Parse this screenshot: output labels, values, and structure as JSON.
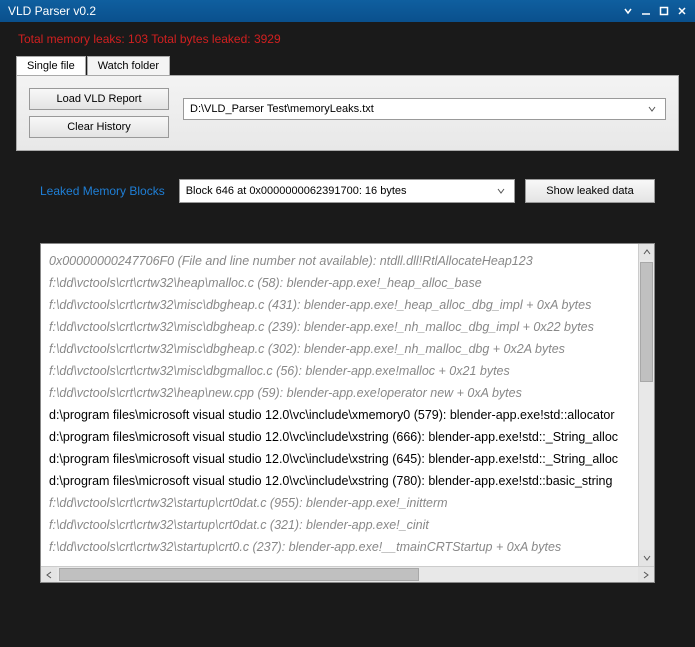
{
  "window": {
    "title": "VLD Parser v0.2"
  },
  "status": {
    "leaks_label": "Total memory leaks:",
    "leaks_count": "103",
    "bytes_label": "Total bytes leaked:",
    "bytes_count": "3929"
  },
  "tabs": {
    "single": "Single file",
    "watch": "Watch folder"
  },
  "panel": {
    "load_btn": "Load VLD Report",
    "clear_btn": "Clear History",
    "file_path": "D:\\VLD_Parser Test\\memoryLeaks.txt"
  },
  "mid": {
    "label": "Leaked Memory Blocks",
    "selected_block": "Block 646 at 0x0000000062391700: 16 bytes",
    "show_btn": "Show leaked data"
  },
  "trace": [
    {
      "dim": true,
      "text": "0x00000000247706F0 (File and line number not available): ntdll.dll!RtlAllocateHeap123"
    },
    {
      "dim": true,
      "text": "f:\\dd\\vctools\\crt\\crtw32\\heap\\malloc.c (58): blender-app.exe!_heap_alloc_base"
    },
    {
      "dim": true,
      "text": "f:\\dd\\vctools\\crt\\crtw32\\misc\\dbgheap.c (431): blender-app.exe!_heap_alloc_dbg_impl + 0xA bytes"
    },
    {
      "dim": true,
      "text": "f:\\dd\\vctools\\crt\\crtw32\\misc\\dbgheap.c (239): blender-app.exe!_nh_malloc_dbg_impl + 0x22 bytes"
    },
    {
      "dim": true,
      "text": "f:\\dd\\vctools\\crt\\crtw32\\misc\\dbgheap.c (302): blender-app.exe!_nh_malloc_dbg + 0x2A bytes"
    },
    {
      "dim": true,
      "text": "f:\\dd\\vctools\\crt\\crtw32\\misc\\dbgmalloc.c (56): blender-app.exe!malloc + 0x21 bytes"
    },
    {
      "dim": true,
      "text": "f:\\dd\\vctools\\crt\\crtw32\\heap\\new.cpp (59): blender-app.exe!operator new + 0xA bytes"
    },
    {
      "dim": false,
      "text": "d:\\program files\\microsoft visual studio 12.0\\vc\\include\\xmemory0 (579): blender-app.exe!std::allocator"
    },
    {
      "dim": false,
      "text": "d:\\program files\\microsoft visual studio 12.0\\vc\\include\\xstring (666): blender-app.exe!std::_String_alloc"
    },
    {
      "dim": false,
      "text": "d:\\program files\\microsoft visual studio 12.0\\vc\\include\\xstring (645): blender-app.exe!std::_String_alloc"
    },
    {
      "dim": false,
      "text": "d:\\program files\\microsoft visual studio 12.0\\vc\\include\\xstring (780): blender-app.exe!std::basic_string"
    },
    {
      "dim": true,
      "text": "f:\\dd\\vctools\\crt\\crtw32\\startup\\crt0dat.c (955): blender-app.exe!_initterm"
    },
    {
      "dim": true,
      "text": "f:\\dd\\vctools\\crt\\crtw32\\startup\\crt0dat.c (321): blender-app.exe!_cinit"
    },
    {
      "dim": true,
      "text": "f:\\dd\\vctools\\crt\\crtw32\\startup\\crt0.c (237): blender-app.exe!__tmainCRTStartup + 0xA bytes"
    }
  ]
}
